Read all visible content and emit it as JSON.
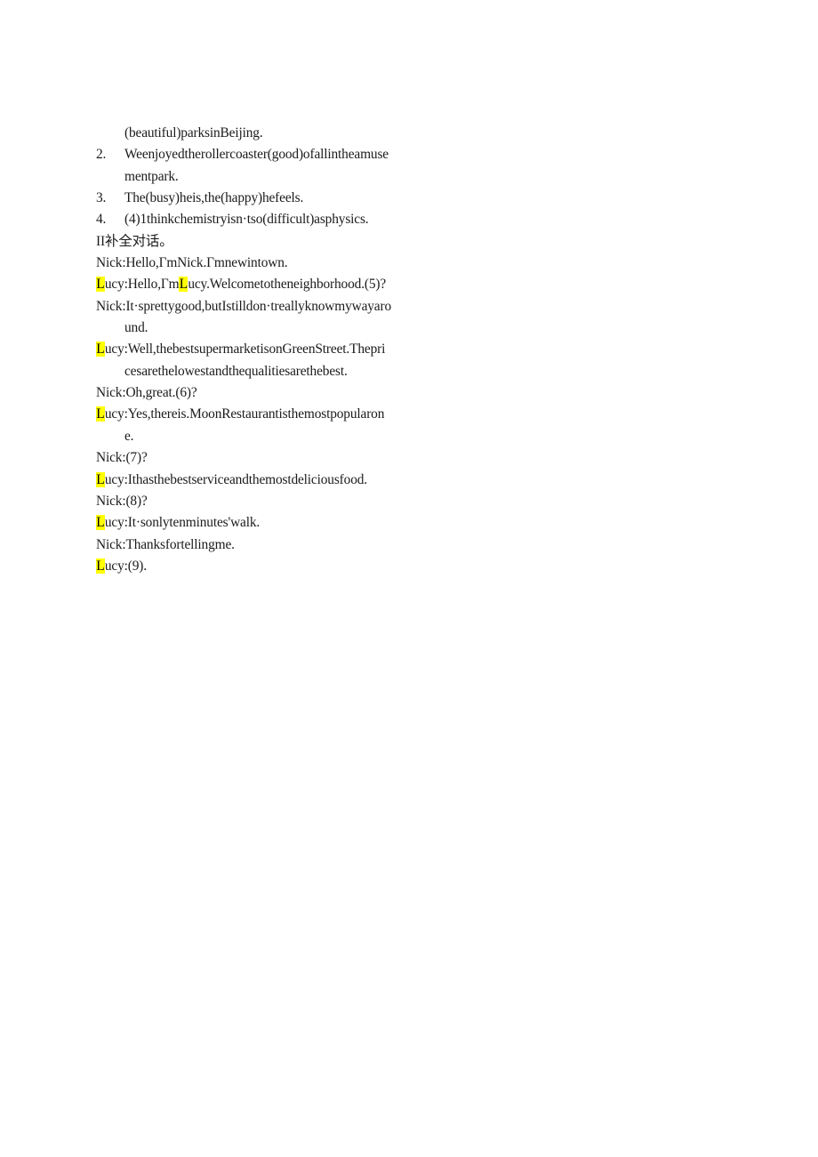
{
  "page": {
    "background_color": "#ffffff",
    "text_color": "#1b1b1b",
    "highlight_color": "#ffff00"
  },
  "exercise_items": {
    "orphan_line": "(beautiful)parksinBeijing.",
    "items": [
      {
        "marker": "2.",
        "text": "Weenjoyedtherollercoaster(good)ofallintheamuse",
        "continuation": "mentpark."
      },
      {
        "marker": "3.",
        "text": "The(busy)heis,the(happy)hefeels.",
        "continuation": ""
      },
      {
        "marker": "4.",
        "text": "(4)1thinkchemistryisn·tso(difficult)asphysics.",
        "continuation": ""
      }
    ]
  },
  "section_heading": "II补全对话。",
  "dialogue": {
    "lines": [
      {
        "highlight": "",
        "text": "Nick:Hello,ΓmNick.Γmnewintown.",
        "continuation": ""
      },
      {
        "highlight": "L",
        "text": "ucy:Hello,Γm",
        "highlight2": "L",
        "text2": "ucy.Welcometotheneighborhood.(5)?",
        "continuation": ""
      },
      {
        "highlight": "",
        "text": "Nick:It·sprettygood,butIstilldon·treallyknowmywayaro",
        "continuation": "und."
      },
      {
        "highlight": "L",
        "text": "ucy:Well,thebestsupermarketisonGreenStreet.Thepri",
        "continuation": "cesarethelowestandthequalitiesarethebest."
      },
      {
        "highlight": "",
        "text": "Nick:Oh,great.(6)?",
        "continuation": ""
      },
      {
        "highlight": "L",
        "text": "ucy:Yes,thereis.MoonRestaurantisthemostpopularon",
        "continuation": "e."
      },
      {
        "highlight": "",
        "text": "Nick:(7)?",
        "continuation": ""
      },
      {
        "highlight": "L",
        "text": "ucy:Ithasthebestserviceandthemostdeliciousfood.",
        "continuation": ""
      },
      {
        "highlight": "",
        "text": "Nick:(8)?",
        "continuation": ""
      },
      {
        "highlight": "L",
        "text": "ucy:It·sonlytenminutes'walk.",
        "continuation": ""
      },
      {
        "highlight": "",
        "text": "Nick:Thanksfortellingme.",
        "continuation": ""
      },
      {
        "highlight": "L",
        "text": "ucy:(9).",
        "continuation": ""
      }
    ]
  }
}
